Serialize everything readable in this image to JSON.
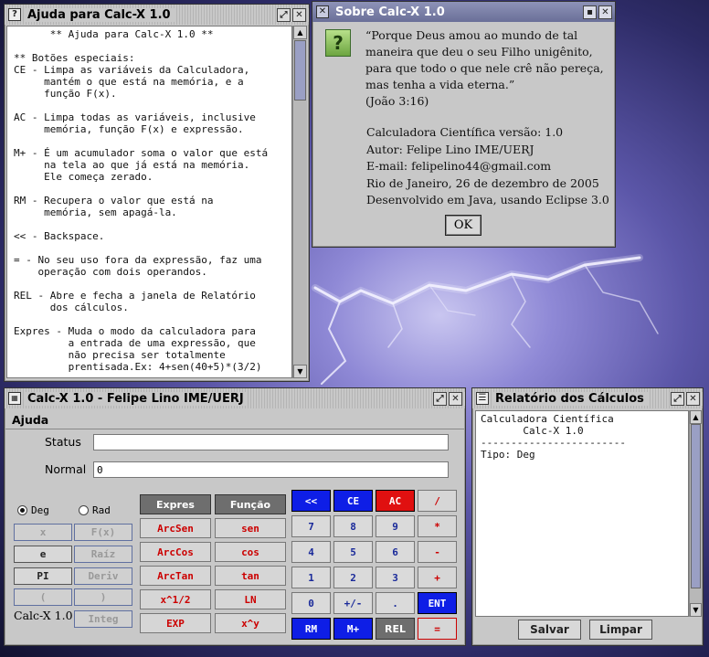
{
  "help_window": {
    "title": "Ajuda para Calc-X 1.0",
    "icon": "help-icon",
    "lines": [
      "      ** Ajuda para Calc-X 1.0 **",
      "",
      "** Botões especiais:",
      "CE - Limpa as variáveis da Calculadora,",
      "     mantém o que está na memória, e a",
      "     função F(x).",
      "",
      "AC - Limpa todas as variáveis, inclusive",
      "     memória, função F(x) e expressão.",
      "",
      "M+ - É um acumulador soma o valor que está",
      "     na tela ao que já está na memória.",
      "     Ele começa zerado.",
      "",
      "RM - Recupera o valor que está na",
      "     memória, sem apagá-la.",
      "",
      "<< - Backspace.",
      "",
      "= - No seu uso fora da expressão, faz uma",
      "    operação com dois operandos.",
      "",
      "REL - Abre e fecha a janela de Relatório",
      "      dos cálculos.",
      "",
      "Expres - Muda o modo da calculadora para",
      "         a entrada de uma expressão, que",
      "         não precisa ser totalmente",
      "         prentisada.Ex: 4+sen(40+5)*(3/2)"
    ]
  },
  "about_window": {
    "title": "Sobre Calc-X 1.0",
    "icon": "question-icon",
    "verse": [
      "“Porque Deus amou ao mundo de tal",
      " maneira que deu o seu Filho unigênito,",
      " para que todo o que nele crê não pereça,",
      " mas tenha a vida eterna.”",
      " (João 3:16)"
    ],
    "info": [
      "Calculadora Científica versão: 1.0",
      "Autor:  Felipe Lino IME/UERJ",
      "E-mail: felipelino44@gmail.com",
      "Rio de Janeiro, 26 de dezembro de 2005",
      "Desenvolvido em Java, usando Eclipse 3.0"
    ],
    "ok": "OK"
  },
  "calc_window": {
    "title": "Calc-X 1.0 - Felipe Lino IME/UERJ",
    "menu": "Ajuda",
    "status_label": "Status",
    "status_value": "",
    "normal_label": "Normal",
    "normal_value": "0",
    "radio_deg": "Deg",
    "radio_rad": "Rad",
    "selected_mode": "Deg",
    "brand": "Calc-X 1.0",
    "left_buttons": [
      "x",
      "F(x)",
      "e",
      "Raíz",
      "PI",
      "Deriv",
      "(",
      ")",
      "Integ"
    ],
    "mid_buttons": [
      "Expres",
      "Função",
      "ArcSen",
      "sen",
      "ArcCos",
      "cos",
      "ArcTan",
      "tan",
      "x^1/2",
      "LN",
      "EXP",
      "x^y"
    ],
    "key_buttons": [
      "<<",
      "CE",
      "AC",
      "/",
      "7",
      "8",
      "9",
      "*",
      "4",
      "5",
      "6",
      "-",
      "1",
      "2",
      "3",
      "+",
      "0",
      "+/-",
      ".",
      "ENT",
      "RM",
      "M+",
      "REL",
      "="
    ]
  },
  "report_window": {
    "title": "Relatório dos Cálculos",
    "icon": "list-icon",
    "lines": [
      "Calculadora Científica",
      "       Calc-X 1.0",
      "------------------------",
      "Tipo: Deg"
    ],
    "save": "Salvar",
    "clear": "Limpar"
  },
  "colors": {
    "accent_blue": "#0e1ee6",
    "accent_red": "#e01010"
  }
}
